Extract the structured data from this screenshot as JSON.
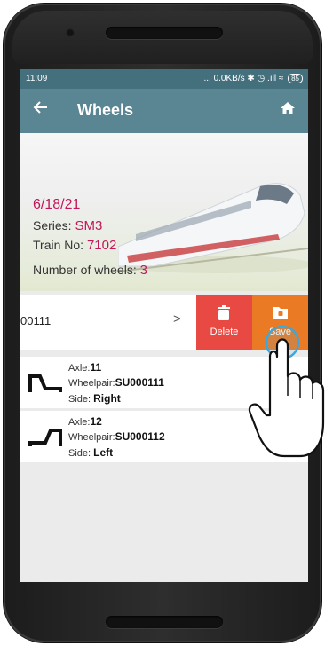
{
  "status_bar": {
    "time": "11:09",
    "right": "... 0.0KB/s ✱ ◷ .ıll ≈",
    "battery": "85"
  },
  "app_bar": {
    "title": "Wheels",
    "back_icon": "arrow-left-icon",
    "home_icon": "home-icon"
  },
  "train_info": {
    "date": "6/18/21",
    "series_label": "Series:",
    "series_value": "SM3",
    "train_no_label": "Train No:",
    "train_no_value": "7102",
    "wheels_label": "Number of wheels:",
    "wheels_value": "3"
  },
  "swiped_row": {
    "code": "00111",
    "delete_label": "Delete",
    "save_label": "Save"
  },
  "wheels": [
    {
      "axle_label": "Axle:",
      "axle": "11",
      "wheelpair_label": "Wheelpair:",
      "wheelpair": "SU000111",
      "side_label": "Side:",
      "side": "Right"
    },
    {
      "axle_label": "Axle:",
      "axle": "12",
      "wheelpair_label": "Wheelpair:",
      "wheelpair": "SU000112",
      "side_label": "Side:",
      "side": "Left"
    }
  ],
  "colors": {
    "status_bar": "#44707d",
    "app_bar": "#5a8593",
    "accent_text": "#c2185b",
    "delete": "#e84a43",
    "save": "#ea7a23"
  }
}
